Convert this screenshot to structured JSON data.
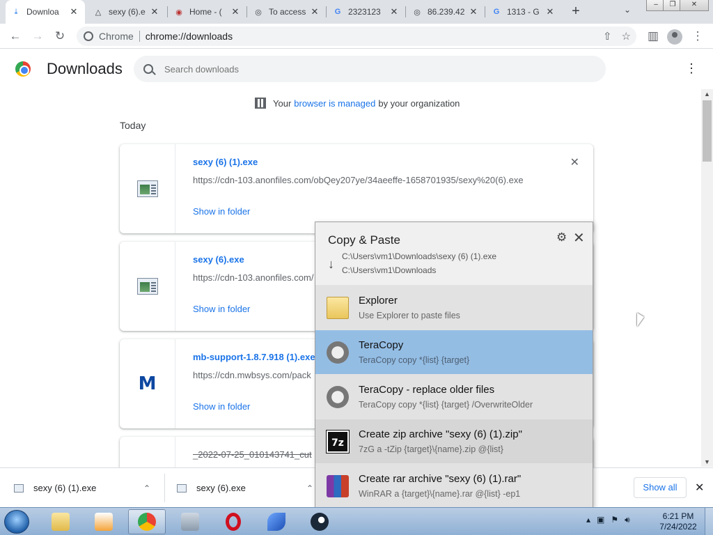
{
  "browser": {
    "tabs": [
      {
        "title": "Downloa",
        "icon": "download-icon",
        "active": true
      },
      {
        "title": "sexy (6).e",
        "icon": "anonfiles-icon"
      },
      {
        "title": "Home - (",
        "icon": "site-icon"
      },
      {
        "title": "To access",
        "icon": "globe-icon"
      },
      {
        "title": "2323123",
        "icon": "google-icon"
      },
      {
        "title": "86.239.42",
        "icon": "globe-icon"
      },
      {
        "title": "1313 - G",
        "icon": "google-icon"
      }
    ],
    "omnibox": {
      "site_label": "Chrome",
      "url": "chrome://downloads"
    }
  },
  "page": {
    "title": "Downloads",
    "search_placeholder": "Search downloads",
    "managed": {
      "prefix": "Your",
      "link": "browser is managed",
      "suffix": "by your organization"
    },
    "date_heading": "Today",
    "downloads": [
      {
        "name": "sexy (6) (1).exe",
        "url": "https://cdn-103.anonfiles.com/obQey207ye/34aeeffe-1658701935/sexy%20(6).exe",
        "action": "Show in folder"
      },
      {
        "name": "sexy (6).exe",
        "url": "https://cdn-103.anonfiles.com/",
        "action": "Show in folder"
      },
      {
        "name": "mb-support-1.8.7.918 (1).exe",
        "url": "https://cdn.mwbsys.com/pack",
        "action": "Show in folder"
      },
      {
        "name": "_2022-07-25_010143741_cut"
      }
    ]
  },
  "shelf": {
    "items": [
      "sexy (6) (1).exe",
      "sexy (6).exe"
    ],
    "show_all": "Show all"
  },
  "popup": {
    "title": "Copy & Paste",
    "source": "C:\\Users\\vm1\\Downloads\\sexy (6) (1).exe",
    "target": "C:\\Users\\vm1\\Downloads",
    "options": [
      {
        "name": "Explorer",
        "desc": "Use Explorer to paste files",
        "icon": "explorer-folder-icon"
      },
      {
        "name": "TeraCopy",
        "desc": "TeraCopy copy *{list} {target}",
        "icon": "teracopy-icon",
        "selected": true
      },
      {
        "name": "TeraCopy - replace older files",
        "desc": "TeraCopy copy *{list} {target} /OverwriteOlder",
        "icon": "teracopy-icon"
      },
      {
        "name": "Create zip archive \"sexy (6) (1).zip\"",
        "desc": "7zG  a -tZip {target}\\{name}.zip @{list}",
        "icon": "7zip-icon",
        "icon_text": "7z"
      },
      {
        "name": "Create rar archive \"sexy (6) (1).rar\"",
        "desc": "WinRAR  a {target}\\{name}.rar @{list} -ep1",
        "icon": "winrar-icon"
      }
    ]
  },
  "taskbar": {
    "time": "6:21 PM",
    "date": "7/24/2022"
  }
}
